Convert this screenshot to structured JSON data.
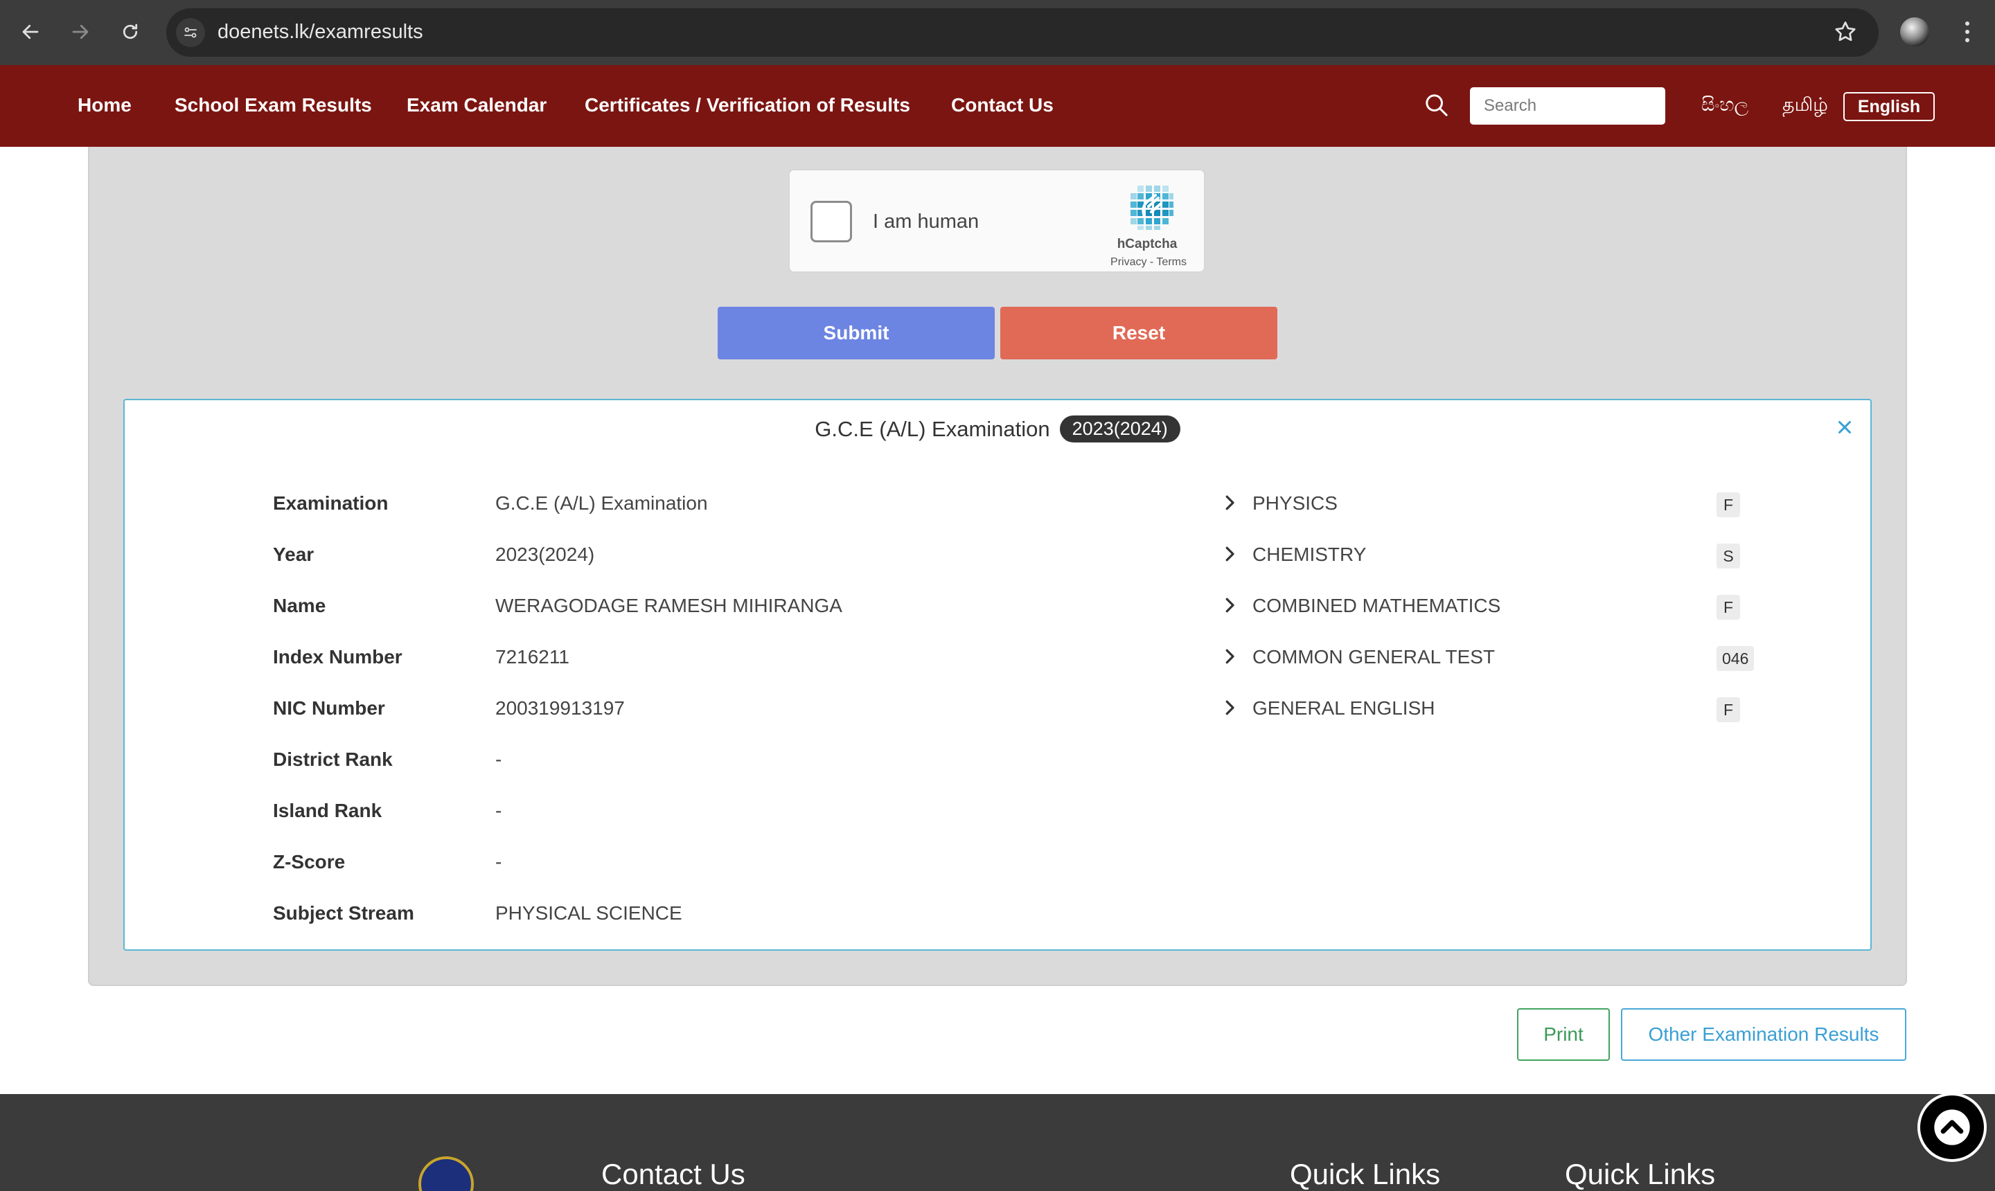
{
  "browser": {
    "url": "doenets.lk/examresults",
    "back_icon": "arrow-left-icon",
    "forward_icon": "arrow-right-icon",
    "reload_icon": "reload-icon",
    "bookmark_icon": "star-icon"
  },
  "nav": {
    "items": [
      {
        "label": "Home"
      },
      {
        "label": "School Exam Results"
      },
      {
        "label": "Exam Calendar"
      },
      {
        "label": "Certificates / Verification of Results"
      },
      {
        "label": "Contact Us"
      }
    ],
    "search_placeholder": "Search",
    "languages": {
      "sinhala": "සිංහල",
      "tamil": "தமிழ்",
      "english": "English"
    },
    "bg_color": "#7b1511"
  },
  "captcha": {
    "label": "I am human",
    "brand": "hCaptcha",
    "links": "Privacy - Terms"
  },
  "form": {
    "submit_label": "Submit",
    "reset_label": "Reset",
    "submit_color": "#6c84e2",
    "reset_color": "#e06a56"
  },
  "result": {
    "title": "G.C.E (A/L) Examination",
    "year_badge": "2023(2024)",
    "details": [
      {
        "label": "Examination",
        "value": "G.C.E (A/L) Examination"
      },
      {
        "label": "Year",
        "value": "2023(2024)"
      },
      {
        "label": "Name",
        "value": "WERAGODAGE RAMESH MIHIRANGA"
      },
      {
        "label": "Index Number",
        "value": "7216211"
      },
      {
        "label": "NIC Number",
        "value": "200319913197"
      },
      {
        "label": "District Rank",
        "value": "-"
      },
      {
        "label": "Island Rank",
        "value": "-"
      },
      {
        "label": "Z-Score",
        "value": "-"
      },
      {
        "label": "Subject Stream",
        "value": "PHYSICAL SCIENCE"
      }
    ],
    "subjects": [
      {
        "name": "PHYSICS",
        "grade": "F"
      },
      {
        "name": "CHEMISTRY",
        "grade": "S"
      },
      {
        "name": "COMBINED MATHEMATICS",
        "grade": "F"
      },
      {
        "name": "COMMON GENERAL TEST",
        "grade": "046"
      },
      {
        "name": "GENERAL ENGLISH",
        "grade": "F"
      }
    ]
  },
  "actions": {
    "print_label": "Print",
    "other_label": "Other Examination Results"
  },
  "footer": {
    "contact_heading": "Contact Us",
    "quick_links_1": "Quick Links",
    "quick_links_2": "Quick Links"
  }
}
